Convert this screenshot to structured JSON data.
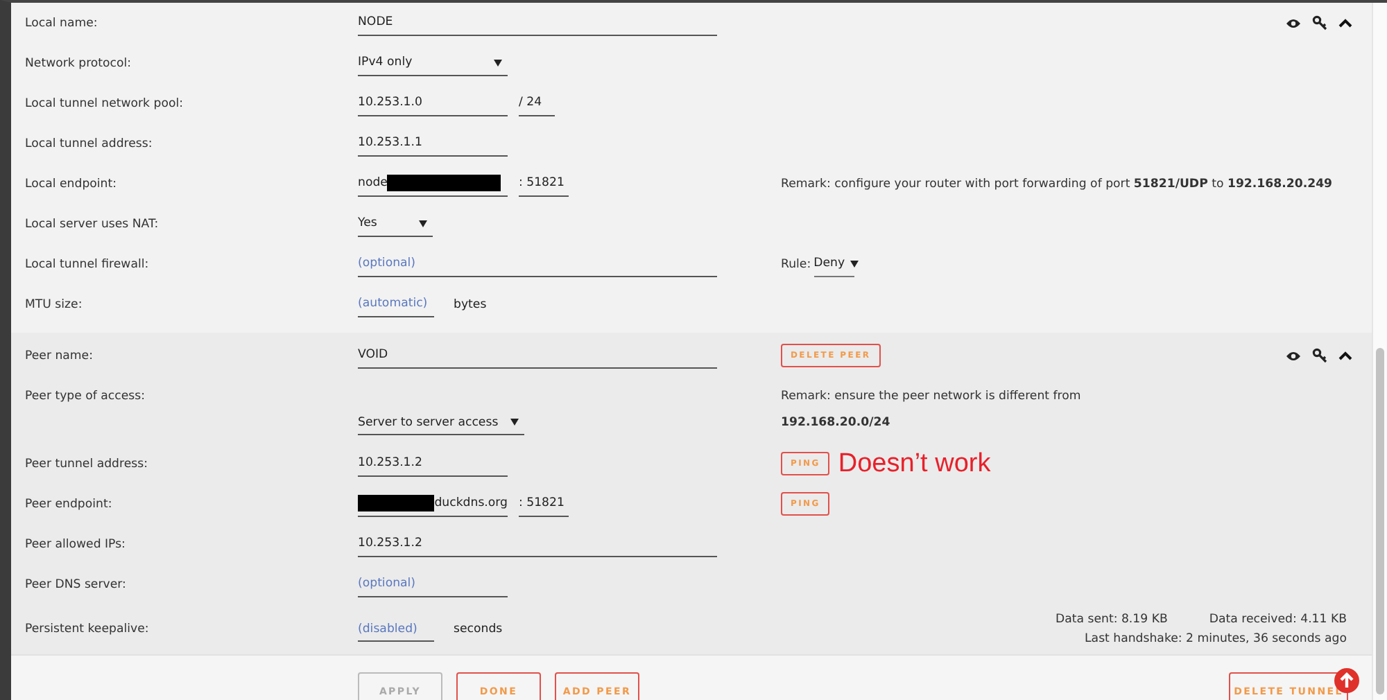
{
  "local": {
    "fields": [
      {
        "label": "Local name:",
        "kind": "wide",
        "value": "NODE"
      },
      {
        "label": "Network protocol:",
        "kind": "select",
        "value": "IPv4 only"
      },
      {
        "label": "Local tunnel network pool:",
        "kind": "pool",
        "value": "10.253.1.0",
        "separator": "/",
        "second": "24"
      },
      {
        "label": "Local tunnel address:",
        "kind": "short",
        "value": "10.253.1.1"
      },
      {
        "label": "Local endpoint:",
        "kind": "endpoint",
        "value": "node",
        "redacted_after": true,
        "port": ": 51821",
        "remark": "Remark: configure your router with port forwarding of port **51821/UDP** to **192.168.20.249**"
      },
      {
        "label": "Local server uses NAT:",
        "kind": "select_small",
        "value": "Yes"
      },
      {
        "label": "Local tunnel firewall:",
        "kind": "wide",
        "placeholder": "(optional)",
        "rule": {
          "label": "Rule:",
          "value": "Deny"
        }
      },
      {
        "label": "MTU size:",
        "kind": "unit",
        "placeholder": "(automatic)",
        "unit": "bytes"
      }
    ]
  },
  "peer": {
    "fields": [
      {
        "label": "Peer name:",
        "kind": "wide",
        "value": "VOID",
        "action": "DELETE PEER"
      },
      {
        "label": "Peer type of access:",
        "kind": "select_tall",
        "value": "Server to server access",
        "remark": "Remark: ensure the peer network is different from",
        "remark_detail": "192.168.20.0/24"
      },
      {
        "label": "Peer tunnel address:",
        "kind": "short",
        "value": "10.253.1.2",
        "action": "PING",
        "annotation": "Doesn’t work"
      },
      {
        "label": "Peer endpoint:",
        "kind": "endpoint",
        "value": "duckdns.org",
        "redacted_before": true,
        "port": ": 51821",
        "action": "PING"
      },
      {
        "label": "Peer allowed IPs:",
        "kind": "wide",
        "value": "10.253.1.2"
      },
      {
        "label": "Peer DNS server:",
        "kind": "short",
        "placeholder": "(optional)"
      },
      {
        "label": "Persistent keepalive:",
        "kind": "unit",
        "placeholder": "(disabled)",
        "unit": "seconds",
        "stats": {
          "sent": "Data sent: 8.19 KB",
          "received": "Data received: 4.11 KB",
          "handshake": "Last handshake: 2 minutes, 36 seconds ago"
        }
      }
    ]
  },
  "buttons": [
    {
      "label": "APPLY",
      "disabled": true
    },
    {
      "label": "DONE",
      "disabled": false
    },
    {
      "label": "ADD PEER",
      "disabled": false
    }
  ],
  "delete_tunnel": {
    "label": "DELETE TUNNEL"
  }
}
